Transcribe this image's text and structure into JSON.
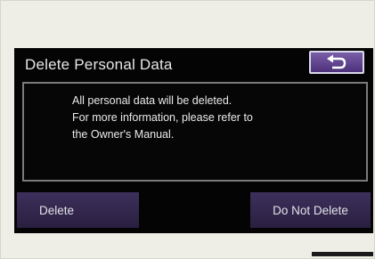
{
  "dialog": {
    "title": "Delete Personal Data",
    "back_icon": "return-arrow-icon",
    "message_lines": [
      "All personal data will be deleted.",
      "For more information, please refer to",
      "the Owner's Manual."
    ]
  },
  "buttons": {
    "delete_label": "Delete",
    "do_not_delete_label": "Do Not Delete"
  },
  "colors": {
    "screen_background": "#040404",
    "button_purple": "#3d305c",
    "back_button_purple": "#6a4f99",
    "text": "#e6e6e6"
  }
}
